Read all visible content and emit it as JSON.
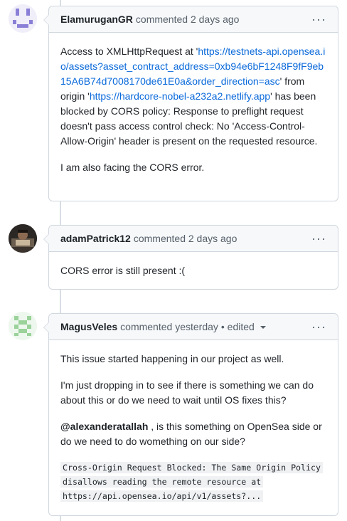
{
  "comments": [
    {
      "author": "ElamuruganGR",
      "meta": "commented 2 days ago",
      "body": {
        "p1_pre": "Access to XMLHttpRequest at '",
        "link1": "https://testnets-api.opensea.io/assets?asset_contract_address=0xb94e6bF1248F9fF9eb15A6B74d7008170de61E0a&order_direction=asc",
        "p1_mid": "' from origin '",
        "link2": "https://hardcore-nobel-a232a2.netlify.app",
        "p1_post": "' has been blocked by CORS policy: Response to preflight request doesn't pass access control check: No 'Access-Control-Allow-Origin' header is present on the requested resource.",
        "p2": "I am also facing the CORS error."
      }
    },
    {
      "author": "adamPatrick12",
      "meta": "commented 2 days ago",
      "body": {
        "p1": "CORS error is still present :("
      }
    },
    {
      "author": "MagusVeles",
      "meta": "commented yesterday",
      "edited": "• edited",
      "body": {
        "p1": "This issue started happening in our project as well.",
        "p2": "I'm just dropping in to see if there is something we can do about this or do we need to wait until OS fixes this?",
        "mention": "@alexanderatallah",
        "p3_post": " , is this something on OpenSea side or do we need to do womething on our side?",
        "code1": "Cross-Origin Request Blocked: The Same Origin Policy",
        "code2": "disallows reading the remote resource at",
        "code3": "https://api.opensea.io/api/v1/assets?..."
      }
    }
  ],
  "menu_glyph": "···",
  "colors": {
    "link": "#0969da",
    "border": "#d0d7de",
    "header_bg": "#f6f8fa"
  }
}
